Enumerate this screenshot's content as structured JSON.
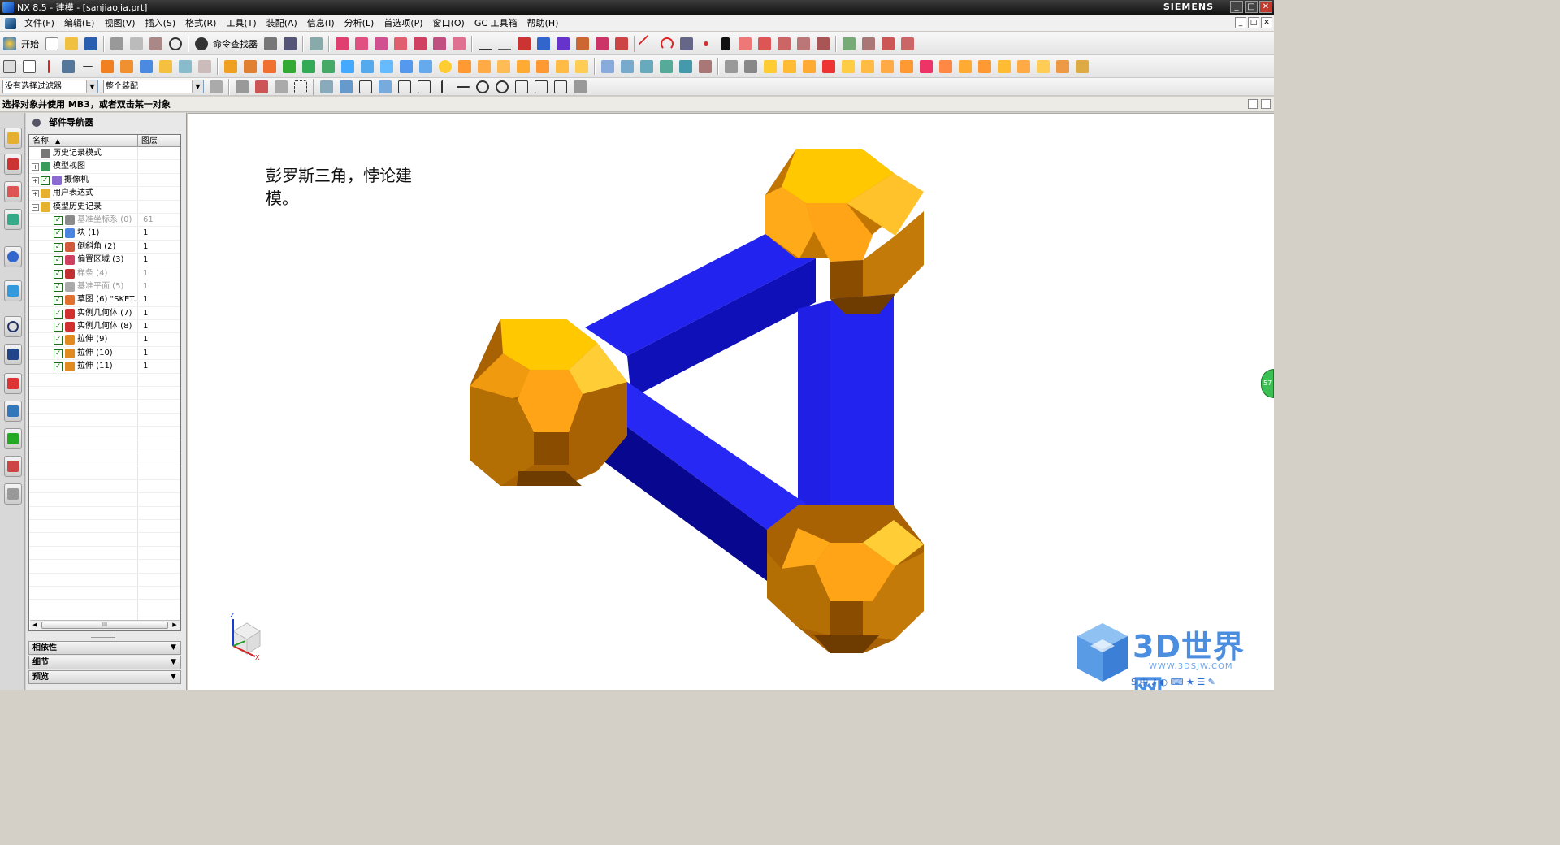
{
  "window": {
    "title": "NX 8.5 - 建模 - [sanjiaojia.prt]",
    "brand": "SIEMENS",
    "min_glyph": "_",
    "max_glyph": "□",
    "close_glyph": "✕"
  },
  "menu": {
    "items": [
      "文件(F)",
      "编辑(E)",
      "视图(V)",
      "插入(S)",
      "格式(R)",
      "工具(T)",
      "装配(A)",
      "信息(I)",
      "分析(L)",
      "首选项(P)",
      "窗口(O)",
      "GC 工具箱",
      "帮助(H)"
    ]
  },
  "toolbar": {
    "start_label": "开始",
    "command_finder_label": "命令查找器"
  },
  "selection_bar": {
    "filter_value": "没有选择过滤器",
    "scope_value": "整个装配"
  },
  "cue_line": "选择对象并使用 MB3，或者双击某一对象",
  "navigator": {
    "title": "部件导航器",
    "col_name": "名称",
    "col_layer": "图层",
    "scroll_thumb": "III",
    "rows": [
      {
        "label": "历史记录模式",
        "layer": ""
      },
      {
        "label": "模型视图",
        "layer": ""
      },
      {
        "label": "摄像机",
        "layer": ""
      },
      {
        "label": "用户表达式",
        "layer": ""
      },
      {
        "label": "模型历史记录",
        "layer": ""
      },
      {
        "label": "基准坐标系 (0)",
        "layer": "61"
      },
      {
        "label": "块 (1)",
        "layer": "1"
      },
      {
        "label": "倒斜角 (2)",
        "layer": "1"
      },
      {
        "label": "偏置区域 (3)",
        "layer": "1"
      },
      {
        "label": "样条 (4)",
        "layer": "1"
      },
      {
        "label": "基准平面 (5)",
        "layer": "1"
      },
      {
        "label": "草图 (6) \"SKET...",
        "layer": "1"
      },
      {
        "label": "实例几何体 (7)",
        "layer": "1"
      },
      {
        "label": "实例几何体 (8)",
        "layer": "1"
      },
      {
        "label": "拉伸 (9)",
        "layer": "1"
      },
      {
        "label": "拉伸 (10)",
        "layer": "1"
      },
      {
        "label": "拉伸 (11)",
        "layer": "1"
      }
    ]
  },
  "panels": {
    "dependencies": "相依性",
    "details": "细节",
    "preview": "预览"
  },
  "viewport": {
    "note": "彭罗斯三角，悖论建模。",
    "axis_z": "Z",
    "axis_x": "X",
    "edge_badge": "57"
  },
  "watermark": {
    "text": "3D世界网",
    "url": "WWW.3DSJW.COM",
    "ime_chars": "S 中 ♪ ◐ ⌨ ★ ☰ ✎"
  },
  "colors": {
    "bar_light": "#2323f0",
    "bar_mid": "#1414d0",
    "bar_dark": "#06068a",
    "node_top": "#ffc800",
    "node_light": "#ffa820",
    "node_mid": "#e08f10",
    "node_side": "#b86f06",
    "node_dark": "#8a4d00"
  }
}
